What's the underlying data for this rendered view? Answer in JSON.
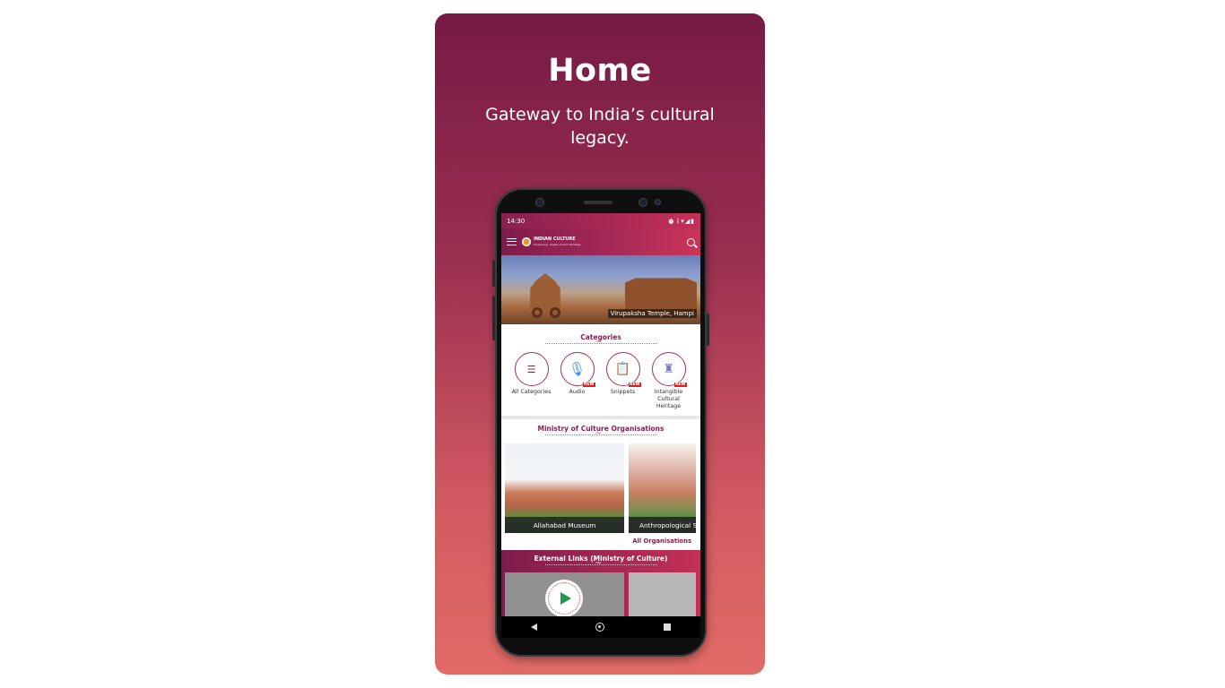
{
  "card": {
    "title": "Home",
    "subtitle": "Gateway to India’s cultural legacy."
  },
  "status_bar": {
    "time": "14:30",
    "icons": [
      "alarm-icon",
      "vibrate-icon",
      "bluetooth-icon",
      "wifi-icon",
      "signal-icon",
      "battery-icon"
    ]
  },
  "app_bar": {
    "logo_title": "INDIAN CULTURE",
    "logo_tagline": "Preserving, Digital, Indian Heritage",
    "menu_icon": "hamburger-icon",
    "search_icon": "search-icon"
  },
  "hero": {
    "caption": "Virupaksha Temple, Hampi"
  },
  "categories": {
    "title": "Categories",
    "items": [
      {
        "label": "All Categories",
        "icon": "list-icon",
        "new": false
      },
      {
        "label": "Audio",
        "icon": "microphone-icon",
        "new": true
      },
      {
        "label": "Snippets",
        "icon": "clipboard-icon",
        "new": true
      },
      {
        "label": "Intangible Cultural Heritage",
        "icon": "dancer-icon",
        "new": true
      }
    ],
    "badge_text": "NEW"
  },
  "organisations": {
    "title": "Ministry of Culture Organisations",
    "items": [
      {
        "label": "Allahabad Museum"
      },
      {
        "label": "Anthropological S"
      }
    ],
    "all_link": "All Organisations"
  },
  "external_links": {
    "title": "External Links (Ministry of Culture)"
  },
  "nav_bar": {
    "back_icon": "back-triangle-icon",
    "home_icon": "home-circle-icon",
    "recent_icon": "recent-square-icon"
  },
  "colors": {
    "card_gradient_top": "#761a45",
    "card_gradient_bottom": "#e26b66",
    "brand": "#8b1f4f",
    "new_badge": "#e02020"
  }
}
